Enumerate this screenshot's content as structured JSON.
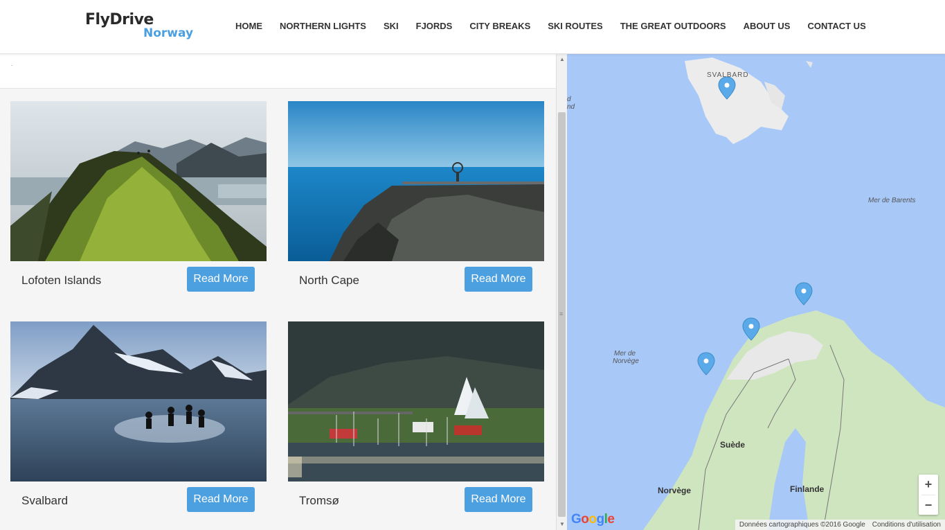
{
  "brand": {
    "name_top": "FlyDrive",
    "name_bottom": "Norway",
    "accent": "#4a9fe0"
  },
  "nav": [
    "HOME",
    "NORTHERN LIGHTS",
    "SKI",
    "FJORDS",
    "CITY BREAKS",
    "SKI ROUTES",
    "THE GREAT OUTDOORS",
    "ABOUT US",
    "CONTACT US"
  ],
  "top_strip": {
    "dot": "."
  },
  "cards": [
    {
      "title": "Lofoten Islands",
      "button": "Read More",
      "image": "mountain-ridge-photo"
    },
    {
      "title": "North Cape",
      "button": "Read More",
      "image": "cliff-sea-photo"
    },
    {
      "title": "Svalbard",
      "button": "Read More",
      "image": "people-swimming-fjord-photo"
    },
    {
      "title": "Tromsø",
      "button": "Read More",
      "image": "arctic-cathedral-harbour-photo"
    }
  ],
  "button_color": "#4da0e0",
  "map": {
    "labels": {
      "svalbard": "SVALBARD",
      "barents": "Mer de Barents",
      "norwegian_sea_1": "Mer de",
      "norwegian_sea_2": "Norvège",
      "suede": "Suède",
      "norvege": "Norvège",
      "finlande": "Finlande",
      "edge_1": "d",
      "edge_2": "nd"
    },
    "zoom_in": "+",
    "zoom_out": "−",
    "google": "Google",
    "attribution": "Données cartographiques ©2016 Google",
    "terms": "Conditions d'utilisation",
    "water_color": "#a8c8f8",
    "land_color": "#cfe5c0",
    "pin_color": "#5aa9e8"
  }
}
